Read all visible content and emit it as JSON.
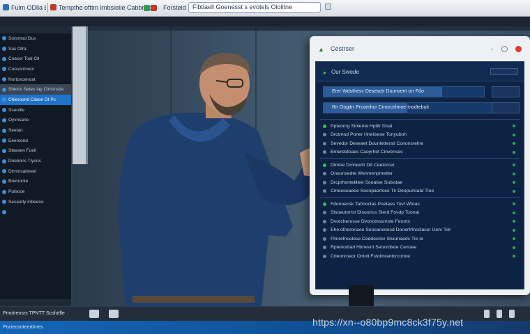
{
  "browser": {
    "tabs": [
      {
        "label": "Fulm   ODlla   E"
      },
      {
        "label": "Tempthe   ofttm  Imbsiotie   Cabbnee"
      },
      {
        "label": "Forsteld  Fmkiey  Mt"
      }
    ],
    "address_text": "Fibtiaell    Goenesst  s  evotels  Oiolitne"
  },
  "sidebar": {
    "items": [
      {
        "label": "Sorsmod Dus"
      },
      {
        "label": "Sas Otra"
      },
      {
        "label": "Coasor Toal Clt"
      },
      {
        "label": "Coosonmeol"
      },
      {
        "label": "Nortoscenoat"
      },
      {
        "label": "Shelos Setes Iay Ciritsnsbe",
        "state": "sel"
      },
      {
        "label": "Chieroond Cilaon Dt  Ps",
        "state": "active"
      },
      {
        "label": "Ssuotlle"
      },
      {
        "label": "Oyvnsane"
      },
      {
        "label": "Seetan"
      },
      {
        "label": "Eeersond"
      },
      {
        "label": "Steasen  Fueil"
      },
      {
        "label": "Dnebons  Tlyoos"
      },
      {
        "label": "Dirntosabneel"
      },
      {
        "label": "Bremonte"
      },
      {
        "label": "Pulsooe"
      },
      {
        "label": "Sesaorly Inbeene"
      },
      {
        "label": ""
      }
    ]
  },
  "monitor": {
    "app_name": "Cestrser",
    "header_label": "Our Swede",
    "bars": [
      {
        "label": "Erer  Wdsthesc  Desesctr  Dounvent  orr  Fdo"
      },
      {
        "label": "Rn  Oogitrr  Pruomhcr  Cmorcelmoe  Inodtebuit"
      }
    ],
    "groups": [
      {
        "rows": [
          {
            "label": "Ppteorng  Sioleme  Hptitr  Doat"
          },
          {
            "label": "Drotmod  Poner  Hnelisese  Tonyuboh"
          },
          {
            "label": "Sevedor  Deseaet  Dounlettersti  Cononsrelne"
          },
          {
            "label": "Bmeretdoaes  Caoyrhet  Cinvenses"
          }
        ]
      },
      {
        "rows": [
          {
            "label": "Dtrdoe  Dmheolh  Dtt  Ceetorcer"
          },
          {
            "label": "Oneonsedte  Wenmenpmetter"
          },
          {
            "label": "Drcprhontelitlee  Sooatoe  Sulsotae"
          },
          {
            "label": "Cmeeooaeoe  Socnpaortsee  Tlr  Deopurloatd  Tloe"
          }
        ]
      },
      {
        "rows": [
          {
            "label": "Fdenoecsk  Tahnoclas  Poetees  Tovt  Wtoas"
          },
          {
            "label": "Slsoeutorrst  Disootrss  Slerd  Fovdp  Toonat"
          },
          {
            "label": "Dvorcherosse  Dvonctnssrnste  Ferorts"
          },
          {
            "label": "Ehe  ofneronaoe  Seocanonesd  Donerfrtnsclaser  Uenr  Tslr"
          },
          {
            "label": "Fhnrefncelose  Ceddectrer  Slsomaeds  Tle  Ie"
          },
          {
            "label": "Rptenodtarl  Hlrnevnt  Seonrdtete  Cenoee"
          },
          {
            "label": "Crleonroeor  Onlolt  Fstolmrantcrcortoe"
          }
        ]
      }
    ]
  },
  "taskbar": {
    "left_text": "Pmotreosrs  TPNTT  Scsfotfle",
    "row2_text": "Pocieosnteertlmes"
  },
  "watermark": "https://xn--o80bp9mc8ck3f75y.net",
  "colors": {
    "accent": "#1f73c9",
    "screen_bg": "#0e2344",
    "status_green": "#3fbf5a",
    "close_red": "#e03a2f"
  }
}
